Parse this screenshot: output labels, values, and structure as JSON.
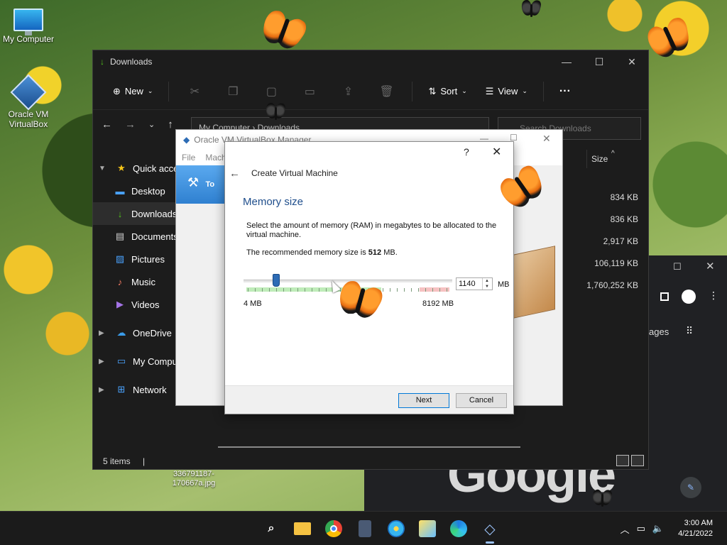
{
  "desktop": {
    "icons": [
      {
        "label": "My Computer"
      },
      {
        "label": "Oracle VM VirtualBox"
      }
    ],
    "file_label": "336791187-170667a.jpg"
  },
  "explorer": {
    "title": "Downloads",
    "toolbar": {
      "new_label": "New",
      "sort_label": "Sort",
      "view_label": "View",
      "more_label": "···"
    },
    "address": "My Computer › Downloads",
    "search_placeholder": "Search Downloads",
    "nav": [
      {
        "label": "Quick access"
      },
      {
        "label": "Desktop"
      },
      {
        "label": "Downloads"
      },
      {
        "label": "Documents"
      },
      {
        "label": "Pictures"
      },
      {
        "label": "Music"
      },
      {
        "label": "Videos"
      },
      {
        "label": "OneDrive"
      },
      {
        "label": "My Computer"
      },
      {
        "label": "Network"
      }
    ],
    "column_size": "Size",
    "sizes": [
      "834 KB",
      "836 KB",
      "2,917 KB",
      "106,119 KB",
      "1,760,252 KB"
    ],
    "status": "5 items"
  },
  "chrome": {
    "images_partial": "ages",
    "logo_text": "Google"
  },
  "vbox_manager": {
    "title": "Oracle VM VirtualBox Manager",
    "menu": [
      "File",
      "Machine"
    ],
    "tools_label": "To"
  },
  "dialog": {
    "help_label": "?",
    "close_label": "✕",
    "heading": "Create Virtual Machine",
    "section_title": "Memory size",
    "description": "Select the amount of memory (RAM) in megabytes to be allocated to the virtual machine.",
    "recommended_prefix": "The recommended memory size is ",
    "recommended_value": "512",
    "recommended_suffix": " MB.",
    "memory_value": "1140",
    "memory_fraction": 0.139,
    "unit": "MB",
    "min_label": "4 MB",
    "max_label": "8192 MB",
    "next_label": "Next",
    "cancel_label": "Cancel"
  },
  "taskbar": {
    "apps": [
      "windows-start-icon",
      "search-icon",
      "file-explorer-icon",
      "chrome-icon",
      "calculator-icon",
      "paint-icon",
      "photos-icon",
      "edge-icon",
      "virtualbox-icon"
    ],
    "time": "3:00 AM",
    "date": "4/21/2022"
  },
  "colors": {
    "accent": "#0078d7",
    "section": "#1f4e8c",
    "slider_thumb": "#2d6cb5"
  }
}
